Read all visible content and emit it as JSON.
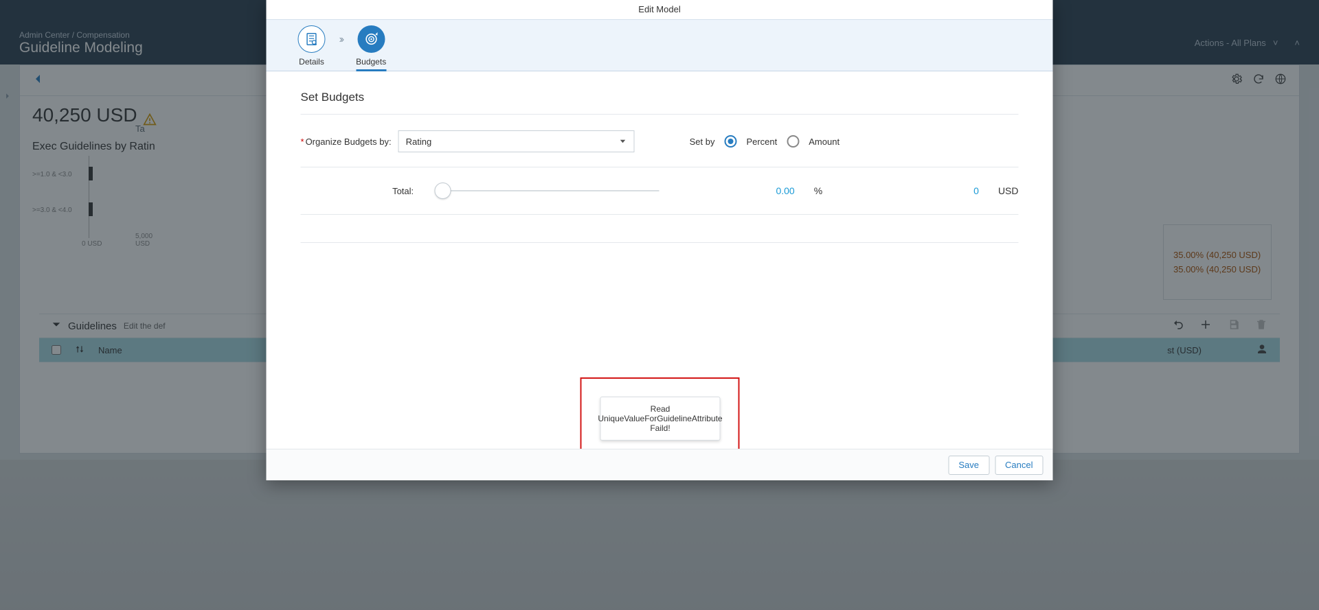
{
  "breadcrumb": "Admin Center / Compensation",
  "page_title": "Guideline Modeling",
  "hero_actions": "Actions - All Plans",
  "panel": {
    "big_value": "40,250 USD",
    "sub_label": "Ta",
    "chart_title": "Exec Guidelines by Ratin",
    "side_box_lines": [
      "35.00% (40,250 USD)",
      "35.00% (40,250 USD)"
    ]
  },
  "chart_data": {
    "type": "bar",
    "orientation": "horizontal",
    "categories": [
      ">=1.0 & <3.0",
      ">=3.0 & <4.0"
    ],
    "values": [
      0,
      0
    ],
    "xlim": [
      0,
      5000
    ],
    "x_ticks": [
      "0 USD",
      "5,000 USD"
    ]
  },
  "guidelines": {
    "section_title": "Guidelines",
    "edit_hint": "Edit the def",
    "col_name": "Name",
    "col_cost": "st (USD)"
  },
  "modal": {
    "title": "Edit Model",
    "steps": {
      "details": "Details",
      "budgets": "Budgets"
    },
    "section": "Set Budgets",
    "organize_label": "Organize Budgets by:",
    "combobox_value": "Rating",
    "setby_label": "Set by",
    "setby_percent": "Percent",
    "setby_amount": "Amount",
    "total_label": "Total:",
    "percent_value": "0.00",
    "percent_unit": "%",
    "usd_value": "0",
    "usd_unit": "USD",
    "toast": "Read UniqueValueForGuidelineAttribute Faild!",
    "save": "Save",
    "cancel": "Cancel"
  }
}
